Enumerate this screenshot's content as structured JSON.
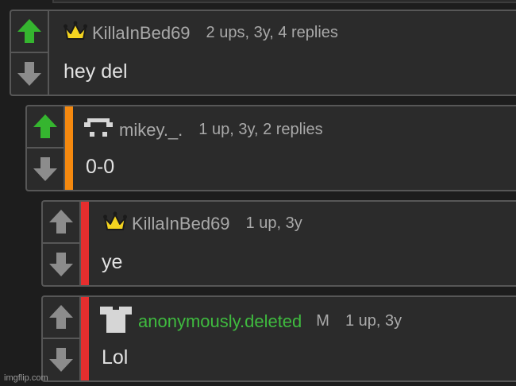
{
  "colors": {
    "upvote_active": "#35b52f",
    "vote_inactive": "#8c8c8c",
    "stripe_orange": "#f5890f",
    "stripe_red": "#e52e2e",
    "username_green": "#3fbb3f"
  },
  "comments": [
    {
      "username": "KillaInBed69",
      "meta": "2 ups, 3y, 4 replies",
      "body": "hey del",
      "badge_icon": "crown-icon",
      "upvoted": true
    },
    {
      "username": "mikey._.",
      "meta": "1 up, 3y, 2 replies",
      "body": "0-0",
      "badge_icon": "pixel-face-icon",
      "upvoted": true
    },
    {
      "username": "KillaInBed69",
      "meta": "1 up, 3y",
      "body": "ye",
      "badge_icon": "crown-icon",
      "upvoted": false
    },
    {
      "username": "anonymously.deleted",
      "mod_tag": "M",
      "meta": "1 up, 3y",
      "body": "Lol",
      "badge_icon": "shirt-icon",
      "upvoted": false
    }
  ],
  "watermark": "imgflip.com"
}
